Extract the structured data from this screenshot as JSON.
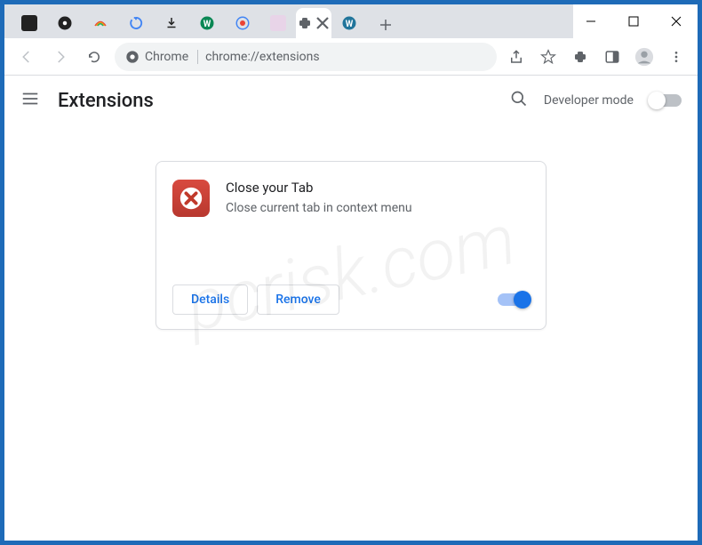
{
  "window": {
    "minimize": "–",
    "maximize": "□",
    "close": "×"
  },
  "tabs": [
    {
      "icon": "tv",
      "color": "#222"
    },
    {
      "icon": "film",
      "color": "#222"
    },
    {
      "icon": "rainbow",
      "color": "#fff"
    },
    {
      "icon": "refresh",
      "color": "#fff"
    },
    {
      "icon": "download",
      "color": "#222"
    },
    {
      "icon": "w",
      "color": "#0a8754"
    },
    {
      "icon": "google",
      "color": "#fff"
    },
    {
      "icon": "generic",
      "color": "#e8d4e8"
    },
    {
      "icon": "puzzle",
      "color": "#fff",
      "active": true
    },
    {
      "icon": "wordpress",
      "color": "#fff"
    }
  ],
  "addressbar": {
    "chip_label": "Chrome",
    "url": "chrome://extensions"
  },
  "page": {
    "title": "Extensions",
    "dev_mode_label": "Developer mode"
  },
  "extension": {
    "name": "Close your Tab",
    "description": "Close current tab in context menu",
    "details_label": "Details",
    "remove_label": "Remove"
  },
  "watermark": "pcrisk.com"
}
